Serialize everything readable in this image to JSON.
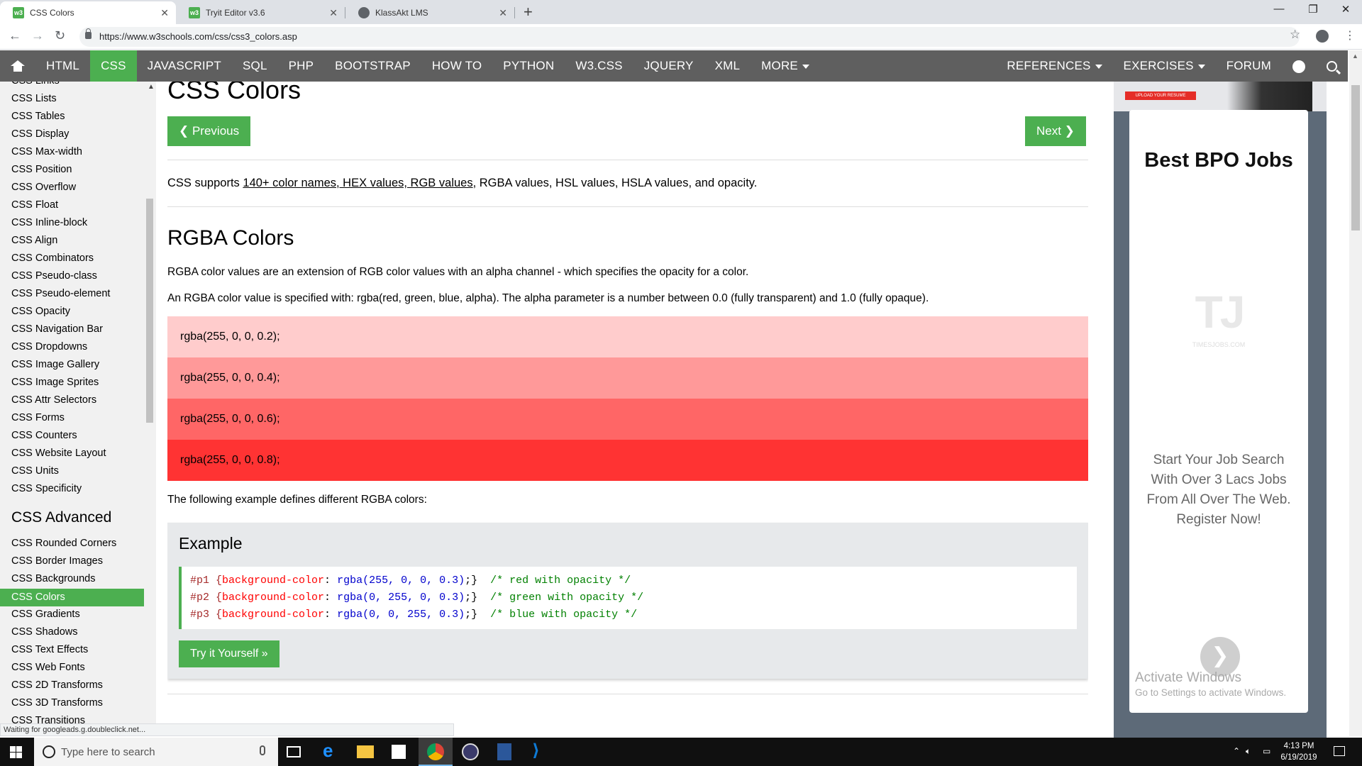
{
  "browser": {
    "tabs": [
      {
        "title": "CSS Colors",
        "icon": "w3schools-favicon"
      },
      {
        "title": "Tryit Editor v3.6",
        "icon": "w3schools-favicon"
      },
      {
        "title": "KlassAkt LMS",
        "icon": "globe-favicon"
      }
    ],
    "url": "https://www.w3schools.com/css/css3_colors.asp",
    "status": "Waiting for googleads.g.doubleclick.net..."
  },
  "topnav": {
    "items": [
      "HTML",
      "CSS",
      "JAVASCRIPT",
      "SQL",
      "PHP",
      "BOOTSTRAP",
      "HOW TO",
      "PYTHON",
      "W3.CSS",
      "JQUERY",
      "XML",
      "MORE"
    ],
    "active": "CSS",
    "right": [
      "REFERENCES",
      "EXERCISES",
      "FORUM"
    ]
  },
  "sidebar": {
    "items": [
      "CSS Links",
      "CSS Lists",
      "CSS Tables",
      "CSS Display",
      "CSS Max-width",
      "CSS Position",
      "CSS Overflow",
      "CSS Float",
      "CSS Inline-block",
      "CSS Align",
      "CSS Combinators",
      "CSS Pseudo-class",
      "CSS Pseudo-element",
      "CSS Opacity",
      "CSS Navigation Bar",
      "CSS Dropdowns",
      "CSS Image Gallery",
      "CSS Image Sprites",
      "CSS Attr Selectors",
      "CSS Forms",
      "CSS Counters",
      "CSS Website Layout",
      "CSS Units",
      "CSS Specificity"
    ],
    "section_heading": "CSS Advanced",
    "advanced": [
      "CSS Rounded Corners",
      "CSS Border Images",
      "CSS Backgrounds",
      "CSS Colors",
      "CSS Gradients",
      "CSS Shadows",
      "CSS Text Effects",
      "CSS Web Fonts",
      "CSS 2D Transforms",
      "CSS 3D Transforms",
      "CSS Transitions"
    ],
    "active": "CSS Colors"
  },
  "main": {
    "title": "CSS Colors",
    "prev_label": "❮ Previous",
    "next_label": "Next ❯",
    "intro_prefix": "CSS supports ",
    "intro_link": "140+ color names, HEX values, RGB values",
    "intro_suffix": ", RGBA values, HSL values, HSLA values, and opacity.",
    "rgba_heading": "RGBA Colors",
    "rgba_p1": "RGBA color values are an extension of RGB color values with an alpha channel - which specifies the opacity for a color.",
    "rgba_p2": "An RGBA color value is specified with: rgba(red, green, blue, alpha). The alpha parameter is a number between 0.0 (fully transparent) and 1.0 (fully opaque).",
    "rgba_rows": [
      {
        "label": "rgba(255, 0, 0, 0.2);",
        "color": "rgba(255, 0, 0, 0.2)"
      },
      {
        "label": "rgba(255, 0, 0, 0.4);",
        "color": "rgba(255, 0, 0, 0.4)"
      },
      {
        "label": "rgba(255, 0, 0, 0.6);",
        "color": "rgba(255, 0, 0, 0.6)"
      },
      {
        "label": "rgba(255, 0, 0, 0.8);",
        "color": "rgba(255, 0, 0, 0.8)"
      }
    ],
    "example_intro": "The following example defines different RGBA colors:",
    "example_heading": "Example",
    "code_lines": [
      {
        "sel": "#p1 {",
        "prop": "background-color",
        "colon": ": ",
        "val": "rgba(255, 0, 0, 0.3)",
        "end": ";}",
        "cmt": "  /* red with opacity */"
      },
      {
        "sel": "#p2 {",
        "prop": "background-color",
        "colon": ": ",
        "val": "rgba(0, 255, 0, 0.3)",
        "end": ";}",
        "cmt": "  /* green with opacity */"
      },
      {
        "sel": "#p3 {",
        "prop": "background-color",
        "colon": ": ",
        "val": "rgba(0, 0, 255, 0.3)",
        "end": ";}",
        "cmt": "  /* blue with opacity */"
      }
    ],
    "tryit_label": "Try it Yourself »"
  },
  "ad": {
    "badge": "UPLOAD YOUR RESUME",
    "title": "Best BPO Jobs",
    "logo": "TJ",
    "logo_sub": "TIMESJOBS.COM",
    "text": "Start Your Job Search With Over 3 Lacs Jobs From All Over The Web. Register Now!",
    "next_icon": "chevron-right-icon"
  },
  "watermark": {
    "line1": "Activate Windows",
    "line2": "Go to Settings to activate Windows."
  },
  "taskbar": {
    "search_placeholder": "Type here to search",
    "time": "4:13 PM",
    "date": "6/19/2019"
  },
  "colors": {
    "w3_green": "#4caf50",
    "nav_gray": "#5f5f5f",
    "sidebar_bg": "#f1f1f1",
    "example_bg": "#e7e9eb"
  }
}
